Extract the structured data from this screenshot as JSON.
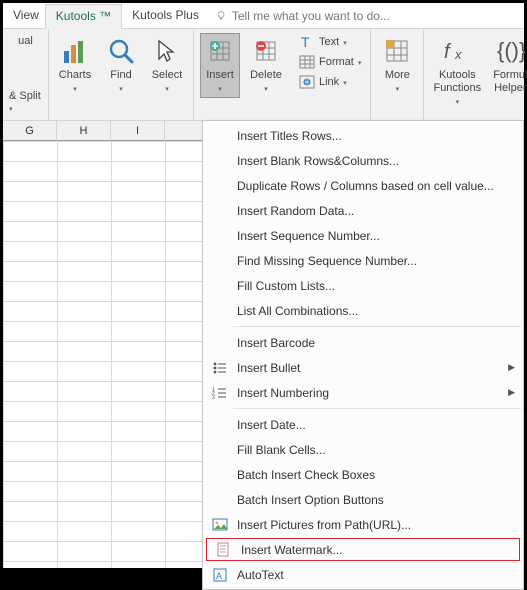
{
  "tabs": {
    "view": "View",
    "kutools": "Kutools ™",
    "kutoolsplus": "Kutools Plus",
    "tellme": "Tell me what you want to do..."
  },
  "ribbon": {
    "left": {
      "ual": "ual",
      "split": "& Split"
    },
    "charts": "Charts",
    "find": "Find",
    "select": "Select",
    "insert": "Insert",
    "delete": "Delete",
    "text": "Text",
    "format": "Format",
    "link": "Link",
    "more": "More",
    "kfunc1": "Kutools",
    "kfunc2": "Functions",
    "fhelp1": "Formul",
    "fhelp2": "Helper"
  },
  "cols": [
    "G",
    "H",
    "I"
  ],
  "menu": {
    "titlesrows": "Insert Titles Rows...",
    "blankrc": "Insert Blank Rows&Columns...",
    "duprc": "Duplicate Rows / Columns based on cell value...",
    "random": "Insert Random Data...",
    "seqnum": "Insert Sequence Number...",
    "findmissing": "Find Missing Sequence Number...",
    "fillcustom": "Fill Custom Lists...",
    "listall": "List All Combinations...",
    "barcode": "Insert Barcode",
    "bullet": "Insert Bullet",
    "numbering": "Insert Numbering",
    "date": "Insert Date...",
    "fillblank": "Fill Blank Cells...",
    "checkboxes": "Batch Insert Check Boxes",
    "optionbtns": "Batch Insert Option Buttons",
    "picurl": "Insert Pictures from Path(URL)...",
    "watermark": "Insert Watermark...",
    "autotext": "AutoText"
  }
}
